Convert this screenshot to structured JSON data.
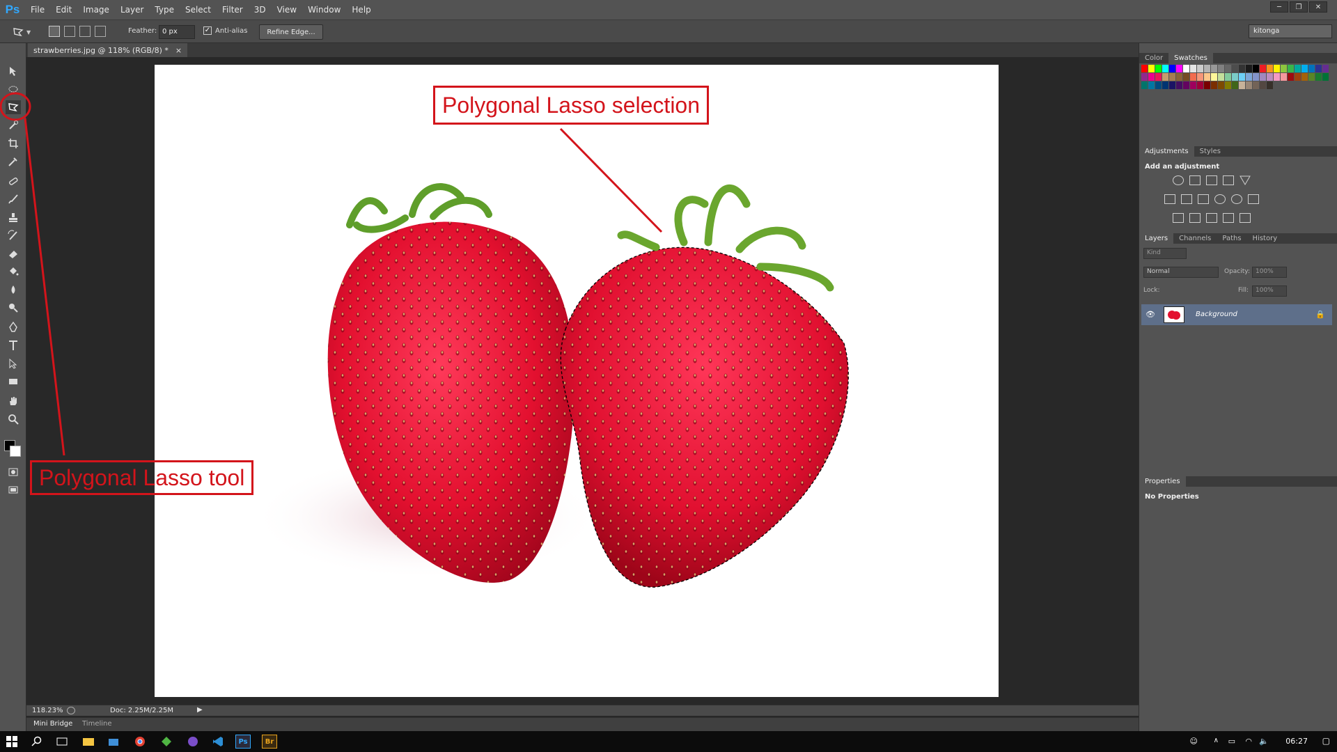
{
  "menubar": {
    "app_logo": "Ps",
    "items": [
      "File",
      "Edit",
      "Image",
      "Layer",
      "Type",
      "Select",
      "Filter",
      "3D",
      "View",
      "Window",
      "Help"
    ],
    "window_controls": [
      "minimize-icon",
      "restore-icon",
      "close-icon"
    ]
  },
  "options": {
    "feather_label": "Feather:",
    "feather_value": "0 px",
    "antialias_label": "Anti-alias",
    "antialias_checked": true,
    "refine_edge_label": "Refine Edge...",
    "workspace": "kitonga"
  },
  "document": {
    "tab_title": "strawberries.jpg @ 118% (RGB/8) *",
    "close_glyph": "×"
  },
  "status": {
    "zoom": "118.23%",
    "doc_size": "Doc: 2.25M/2.25M"
  },
  "minibridge": {
    "tabs": [
      "Mini Bridge",
      "Timeline"
    ]
  },
  "panels": {
    "color_tabs": [
      "Color",
      "Swatches"
    ],
    "adjustment_tabs": [
      "Adjustments",
      "Styles"
    ],
    "add_adjustment": "Add an adjustment",
    "layers_tabs": [
      "Layers",
      "Channels",
      "Paths",
      "History"
    ],
    "kind_label": "Kind",
    "blend_mode": "Normal",
    "opacity_label": "Opacity:",
    "opacity_value": "100%",
    "lock_label": "Lock:",
    "fill_label": "Fill:",
    "fill_value": "100%",
    "layer_name": "Background",
    "properties_title": "Properties",
    "no_properties": "No Properties"
  },
  "annotations": {
    "selection_label": "Polygonal Lasso selection",
    "tool_label": "Polygonal Lasso tool",
    "color": "#d3141b"
  },
  "taskbar": {
    "clock": "06:27",
    "app_icons": [
      "windows-start-icon",
      "search-icon",
      "task-view-icon",
      "file-explorer-icon",
      "store-icon",
      "chrome-icon",
      "sourcetree-icon",
      "app-icon",
      "vscode-icon",
      "photoshop-icon",
      "bridge-icon"
    ],
    "ps_label": "Ps",
    "br_label": "Br"
  },
  "colors": {
    "menubar": "#535353",
    "panel": "#535353",
    "canvas_bg": "#282828",
    "selected_layer": "#5e6f8a",
    "accent_annotation": "#d3141b"
  }
}
